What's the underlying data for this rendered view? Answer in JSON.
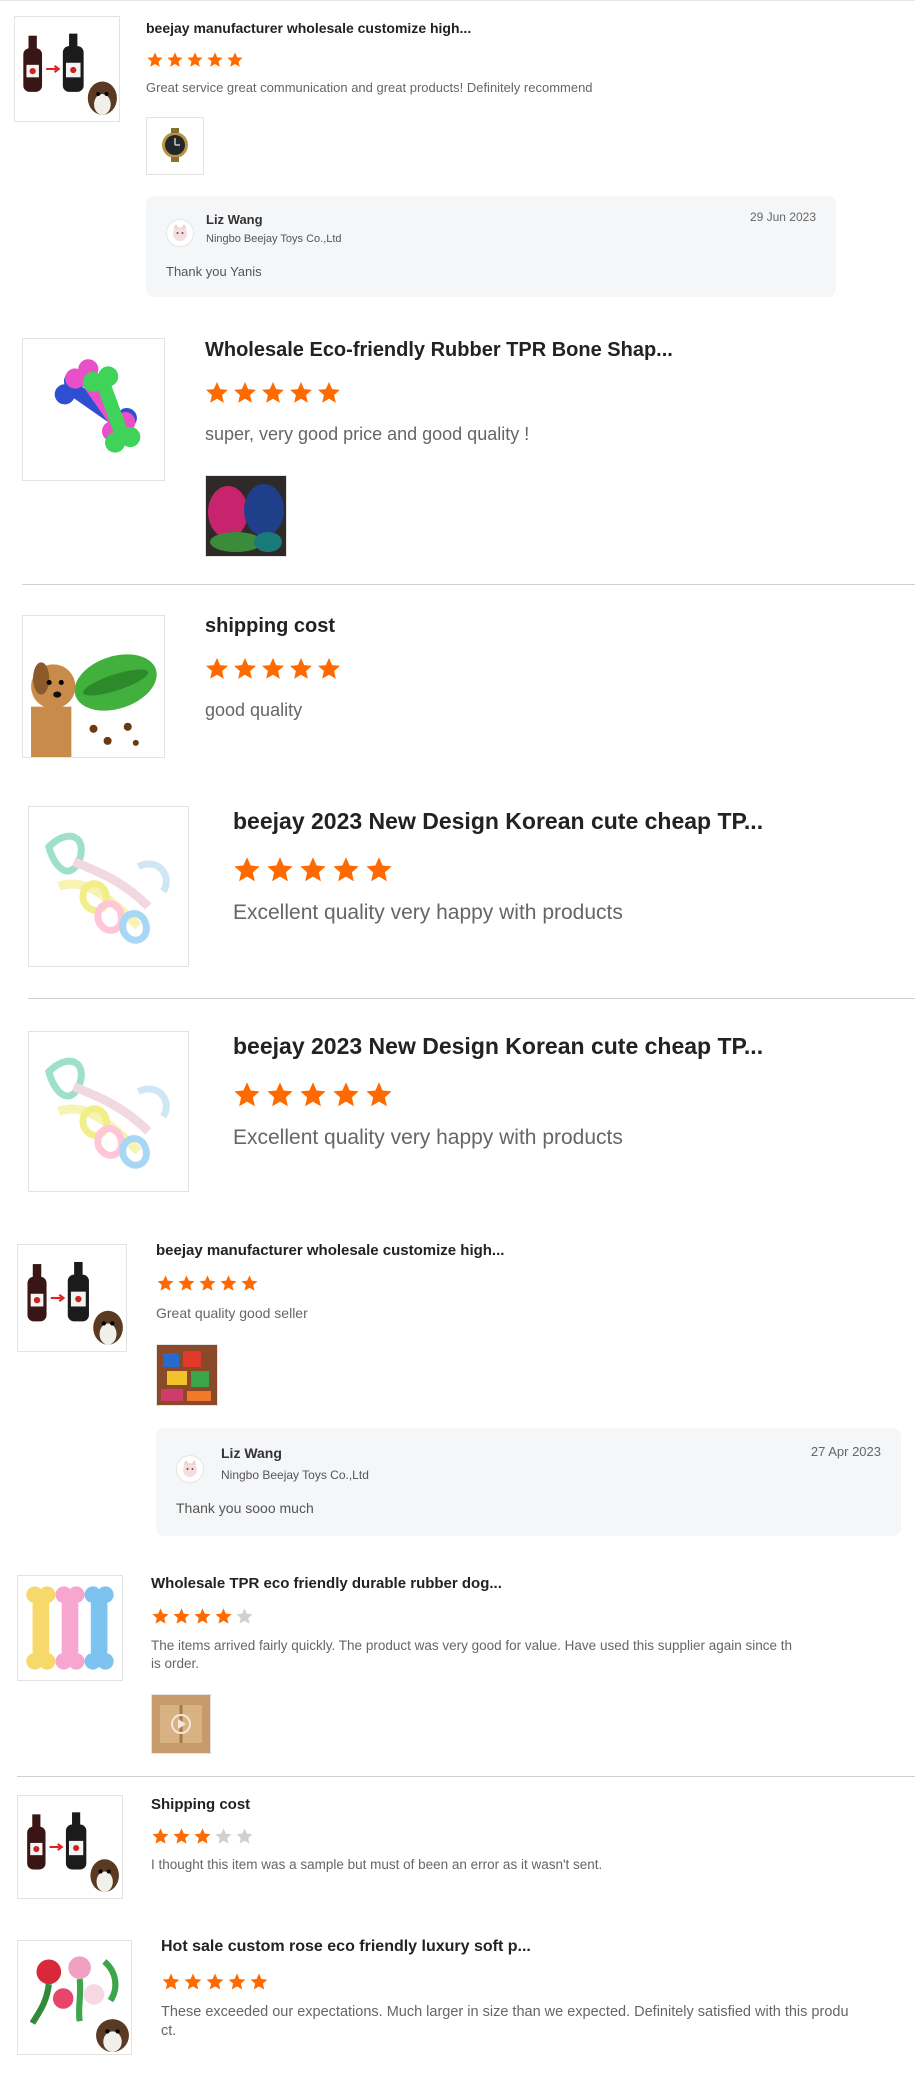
{
  "colors": {
    "star_filled": "#ff6a00",
    "star_empty": "#d0d0d0",
    "reply_bg": "#f5f6f8",
    "divider": "#cfcfcf"
  },
  "reviews": [
    {
      "product": "beejay manufacturer wholesale customize high...",
      "thumb": "wine-bottle-dog-toy",
      "rating": 5,
      "text": "Great service great communication and great products! Definitely recommend",
      "photos": [
        "watch-photo"
      ],
      "reply": {
        "name": "Liz Wang",
        "company": "Ningbo Beejay Toys Co.,Ltd",
        "date": "29 Jun 2023",
        "message": "Thank you Yanis"
      }
    },
    {
      "product": "Wholesale Eco-friendly Rubber TPR Bone Shap...",
      "thumb": "rubber-bone-toys",
      "rating": 5,
      "text": "super, very good price and good quality !",
      "photos": [
        "toy-pile-photo"
      ]
    },
    {
      "product": "shipping cost",
      "thumb": "dog-with-treat-ball",
      "rating": 5,
      "text": "good quality"
    },
    {
      "product": "beejay 2023 New Design Korean cute cheap TP...",
      "thumb": "rope-ring-toys",
      "rating": 5,
      "text": "Excellent quality very happy with products"
    },
    {
      "product": "beejay 2023 New Design Korean cute cheap TP...",
      "thumb": "rope-ring-toys",
      "rating": 5,
      "text": "Excellent quality very happy with products"
    },
    {
      "product": "beejay manufacturer wholesale customize high...",
      "thumb": "wine-bottle-dog-toy",
      "rating": 5,
      "text": "Great quality good seller",
      "photos": [
        "colorful-toys-photo"
      ],
      "reply": {
        "name": "Liz Wang",
        "company": "Ningbo Beejay Toys Co.,Ltd",
        "date": "27 Apr 2023",
        "message": "Thank you sooo much"
      }
    },
    {
      "product": "Wholesale TPR eco friendly durable rubber dog...",
      "thumb": "colored-bone-toys",
      "rating": 4,
      "text_lines": [
        "The items arrived fairly quickly. The product was very good for value. Have used this supplier again since th",
        "is order."
      ],
      "photos": [
        "package-photo"
      ]
    },
    {
      "product": "Shipping cost",
      "thumb": "wine-bottle-dog-toy",
      "rating": 3,
      "text": "I thought this item was a sample but must of been an error as it wasn't sent."
    },
    {
      "product": "Hot sale custom rose eco friendly luxury soft p...",
      "thumb": "rose-plush-toys",
      "rating": 5,
      "text_lines": [
        "These exceeded our expectations. Much larger in size than we expected. Definitely satisfied with this produ",
        "ct."
      ]
    }
  ]
}
